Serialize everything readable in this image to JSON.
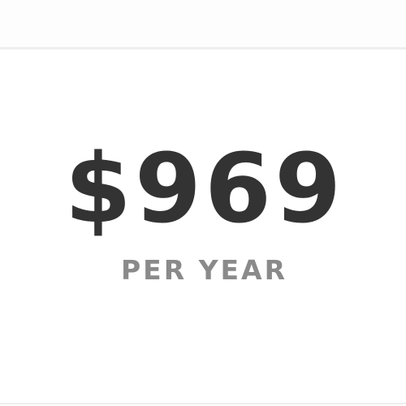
{
  "pricing": {
    "price": "$969",
    "period": "PER YEAR"
  },
  "colors": {
    "price_text": "#333333",
    "period_text": "#8a8a8a",
    "divider": "#eeeeee",
    "background": "#ffffff"
  }
}
